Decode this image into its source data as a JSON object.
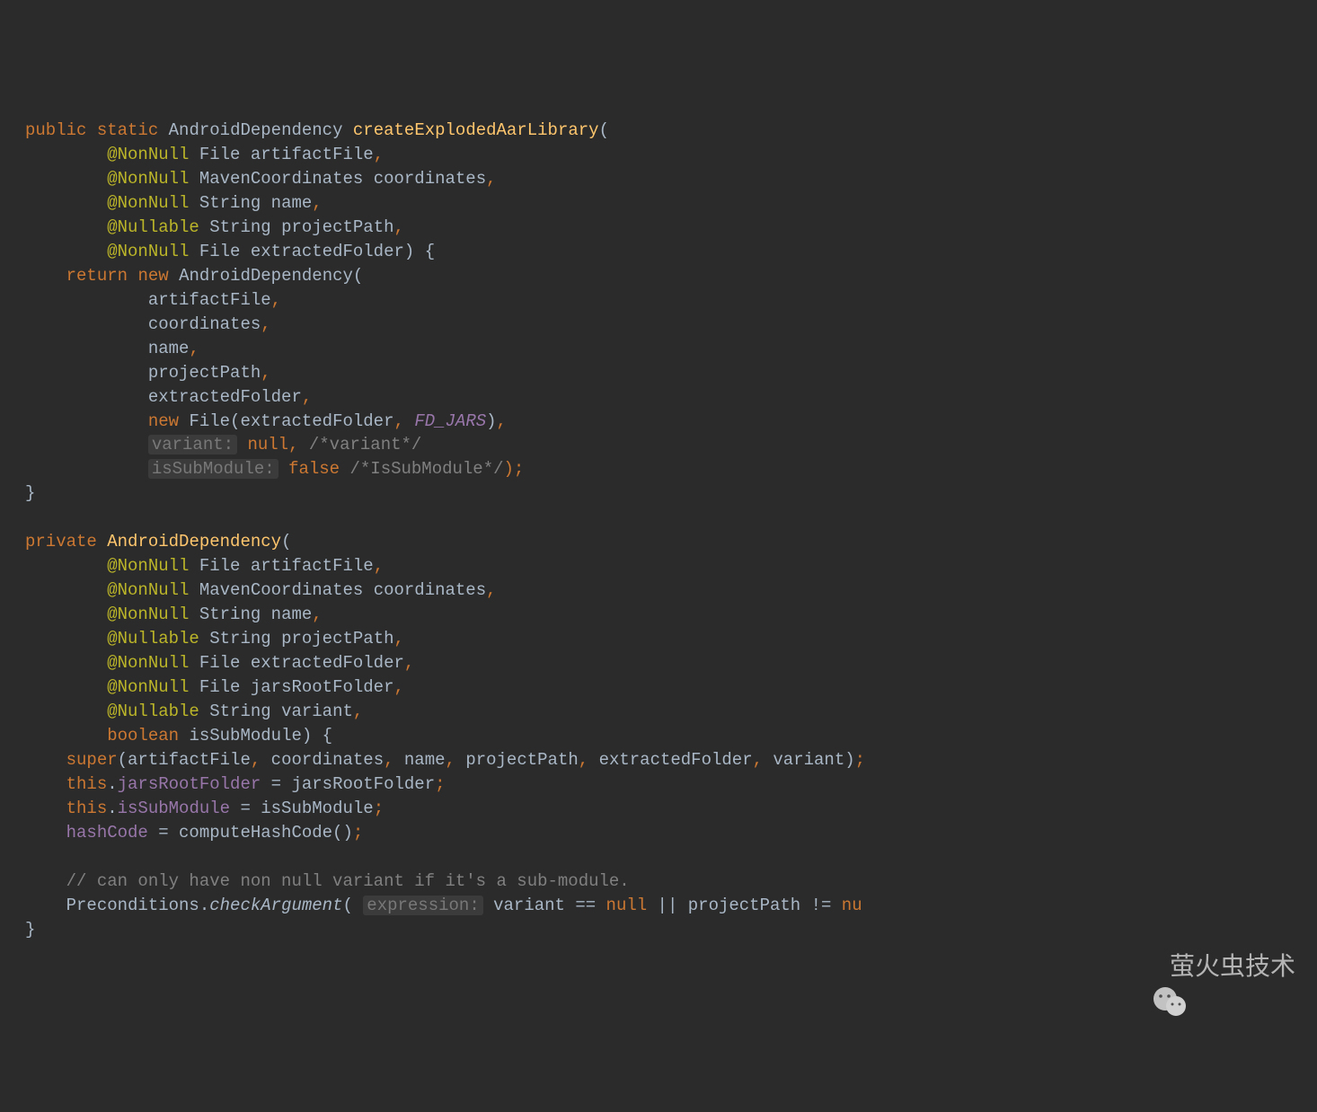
{
  "method1": {
    "modifiers": {
      "public": "public",
      "static": "static"
    },
    "returnType": "AndroidDependency",
    "name": "createExplodedAarLibrary",
    "openParen": "(",
    "params": [
      {
        "annotation": "@NonNull",
        "type": "File",
        "name": "artifactFile",
        "comma": ","
      },
      {
        "annotation": "@NonNull",
        "type": "MavenCoordinates",
        "name": "coordinates",
        "comma": ","
      },
      {
        "annotation": "@NonNull",
        "type": "String",
        "name": "name",
        "comma": ","
      },
      {
        "annotation": "@Nullable",
        "type": "String",
        "name": "projectPath",
        "comma": ","
      },
      {
        "annotation": "@NonNull",
        "type": "File",
        "name": "extractedFolder",
        "close": ") {"
      }
    ],
    "body": {
      "return": "return",
      "new": "new",
      "ctor": "AndroidDependency(",
      "args": {
        "a1": "artifactFile",
        "a2": "coordinates",
        "a3": "name",
        "a4": "projectPath",
        "a5": "extractedFolder",
        "newKw": "new",
        "fileCall": "File(extractedFolder",
        "fdJars": "FD_JARS",
        "fileClose": ")",
        "hint1": "variant:",
        "null": "null",
        "comment1": "/*variant*/",
        "hint2": "isSubModule:",
        "false": "false",
        "comment2": "/*IsSubModule*/",
        "end": ");"
      }
    },
    "close": "}"
  },
  "method2": {
    "modifier": "private",
    "name": "AndroidDependency",
    "openParen": "(",
    "params": [
      {
        "annotation": "@NonNull",
        "type": "File",
        "name": "artifactFile",
        "comma": ","
      },
      {
        "annotation": "@NonNull",
        "type": "MavenCoordinates",
        "name": "coordinates",
        "comma": ","
      },
      {
        "annotation": "@NonNull",
        "type": "String",
        "name": "name",
        "comma": ","
      },
      {
        "annotation": "@Nullable",
        "type": "String",
        "name": "projectPath",
        "comma": ","
      },
      {
        "annotation": "@NonNull",
        "type": "File",
        "name": "extractedFolder",
        "comma": ","
      },
      {
        "annotation": "@NonNull",
        "type": "File",
        "name": "jarsRootFolder",
        "comma": ","
      },
      {
        "annotation": "@Nullable",
        "type": "String",
        "name": "variant",
        "comma": ","
      },
      {
        "kw": "boolean",
        "name": "isSubModule",
        "close": ") {"
      }
    ],
    "body": {
      "super": "super",
      "superArgs": "(artifactFile",
      "superArgs2": "coordinates",
      "superArgs3": "name",
      "superArgs4": "projectPath",
      "superArgs5": "extractedFolder",
      "superArgs6": "variant)",
      "this1": "this",
      "dot": ".",
      "field1": "jarsRootFolder",
      "assign1": " = jarsRootFolder",
      "this2": "this",
      "field2": "isSubModule",
      "assign2": " = isSubModule",
      "field3": "hashCode",
      "assign3": " = computeHashCode()",
      "comment": "// can only have non null variant if it's a sub-module.",
      "precond": "Preconditions.",
      "checkArg": "checkArgument",
      "hintExpr": "expression:",
      "varEq": " variant == ",
      "null1": "null",
      "or": " || projectPath != ",
      "null2": "nu",
      "semi": ";"
    },
    "close": "}"
  },
  "watermark": "萤火虫技术"
}
